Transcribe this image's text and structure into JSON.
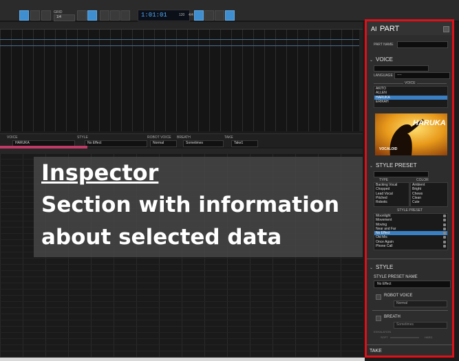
{
  "toolbar": {
    "grid_label": "GRID",
    "grid_value": "1/4",
    "time": "1:01:01",
    "tempo": "120",
    "signature": "4/4"
  },
  "part_bar": {
    "voice_label": "VOICE",
    "voice_value": "HARUKA",
    "style_label": "STYLE",
    "style_value": "No Effect",
    "robot_label": "ROBOT VOICE",
    "robot_value": "Normal",
    "breath_label": "BREATH",
    "breath_value": "Sometimes",
    "take_label": "TAKE",
    "take_value": "Take1"
  },
  "overlay": {
    "title": "Inspector",
    "line1": "Section with information",
    "line2": "about selected data"
  },
  "inspector": {
    "ai_label": "AI",
    "title": "PART",
    "part_name_label": "PART NAME",
    "voice_section": "VOICE",
    "language_label": "LANGUAGE",
    "language_value": "----",
    "voice_list_header": "VOICE",
    "voices": [
      "AKITO",
      "ALLEN",
      "HARUKA",
      "ERIKAH"
    ],
    "selected_voice": "HARUKA",
    "voice_image_name": "HARUKA",
    "voice_image_brand": "VOCALOID",
    "style_preset_section": "STYLE PRESET",
    "type_header": "TYPE",
    "color_header": "COLOR",
    "types": [
      "Backing Vocal",
      "Chopped",
      "Lead Vocal",
      "Pitched",
      "Robotic"
    ],
    "colors": [
      "Ambient",
      "Bright",
      "Chews",
      "Clean",
      "Cute"
    ],
    "style_preset_header": "STYLE PRESET",
    "presets": [
      "Moonlight",
      "Movement",
      "Moving",
      "Near and Far",
      "No Effect",
      "Old Mic",
      "Once Again",
      "Phone Call"
    ],
    "selected_preset": "No Effect",
    "style_section": "STYLE",
    "style_preset_name_label": "STYLE PRESET NAME",
    "style_preset_name_value": "No Effect",
    "robot_voice_label": "ROBOT VOICE",
    "robot_voice_value": "Normal",
    "breath_label": "BREATH",
    "breath_value": "Sometimes",
    "exhalation_label": "EXHALATION",
    "soft_label": "SOFT",
    "hard_label": "HARD",
    "take_section": "TAKE"
  }
}
